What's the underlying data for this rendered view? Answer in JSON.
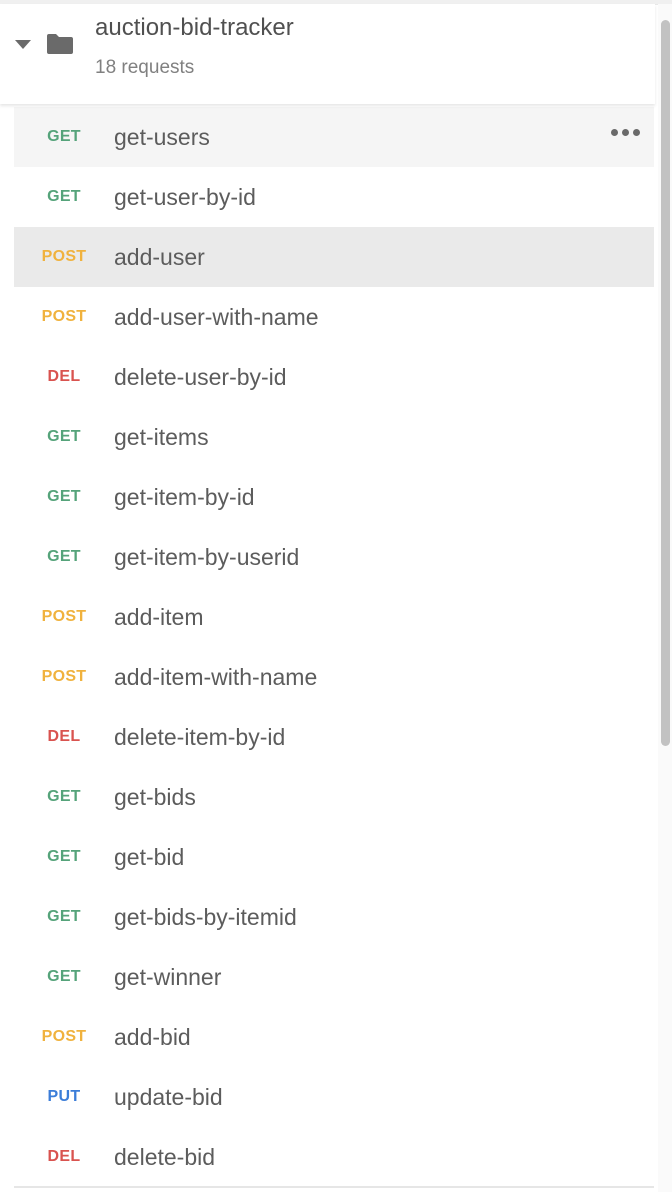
{
  "collection": {
    "name": "auction-bid-tracker",
    "meta": "18 requests"
  },
  "icons": {
    "expand": "caret-down-icon",
    "folder": "folder-icon",
    "more": "more-options-icon"
  },
  "colors": {
    "GET": "#55a37a",
    "POST": "#f0b23e",
    "DEL": "#d9534f",
    "PUT": "#3b7dd8"
  },
  "requests": [
    {
      "method": "GET",
      "name": "get-users"
    },
    {
      "method": "GET",
      "name": "get-user-by-id"
    },
    {
      "method": "POST",
      "name": "add-user"
    },
    {
      "method": "POST",
      "name": "add-user-with-name"
    },
    {
      "method": "DEL",
      "name": "delete-user-by-id"
    },
    {
      "method": "GET",
      "name": "get-items"
    },
    {
      "method": "GET",
      "name": "get-item-by-id"
    },
    {
      "method": "GET",
      "name": "get-item-by-userid"
    },
    {
      "method": "POST",
      "name": "add-item"
    },
    {
      "method": "POST",
      "name": "add-item-with-name"
    },
    {
      "method": "DEL",
      "name": "delete-item-by-id"
    },
    {
      "method": "GET",
      "name": "get-bids"
    },
    {
      "method": "GET",
      "name": "get-bid"
    },
    {
      "method": "GET",
      "name": "get-bids-by-itemid"
    },
    {
      "method": "GET",
      "name": "get-winner"
    },
    {
      "method": "POST",
      "name": "add-bid"
    },
    {
      "method": "PUT",
      "name": "update-bid"
    },
    {
      "method": "DEL",
      "name": "delete-bid"
    }
  ]
}
